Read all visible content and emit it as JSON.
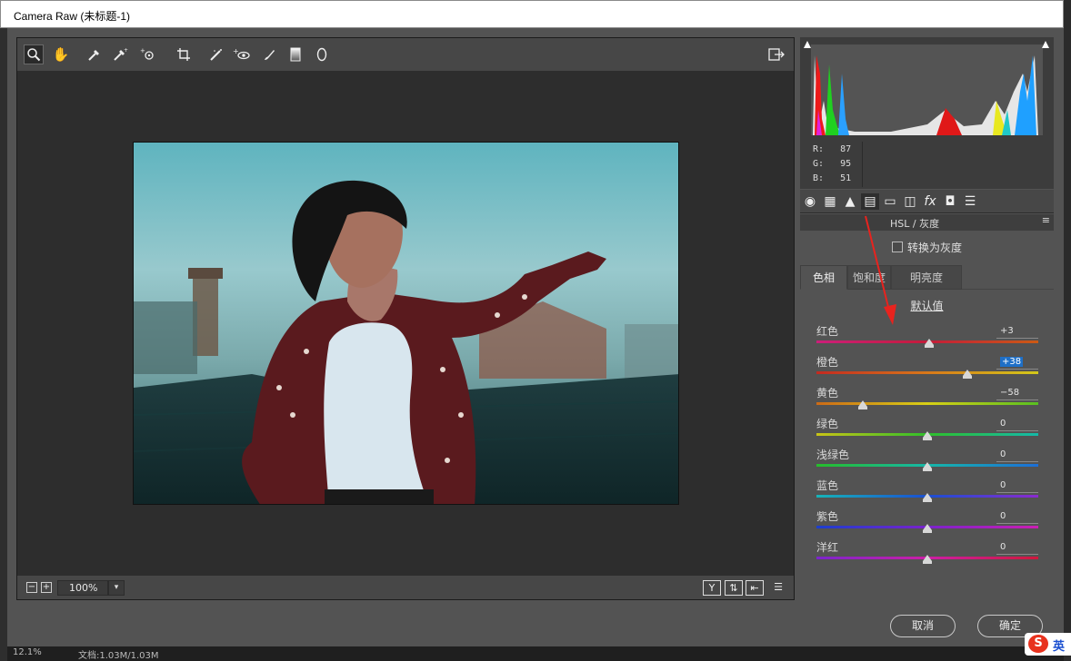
{
  "window": {
    "title": "Camera Raw (未标题-1)"
  },
  "toolbar": {
    "tools": [
      "zoom-icon",
      "hand-icon",
      "white-balance-icon",
      "color-sampler-icon",
      "targeted-adjust-icon",
      "crop-icon",
      "spot-removal-icon",
      "red-eye-icon",
      "adjustment-brush-icon",
      "graduated-filter-icon",
      "radial-filter-icon"
    ],
    "export_icon": "open-export-icon"
  },
  "zoom": {
    "minus": "−",
    "plus": "+",
    "value": "100%"
  },
  "rgb_readout": {
    "r_label": "R:",
    "r": "87",
    "g_label": "G:",
    "g": "95",
    "b_label": "B:",
    "b": "51"
  },
  "panel": {
    "title": "HSL / 灰度",
    "grayscale_label": "转换为灰度",
    "tabs": [
      "色相",
      "饱和度",
      "明亮度"
    ],
    "active_tab": "色相",
    "default_link": "默认值",
    "sliders": [
      {
        "label": "红色",
        "value": "+3",
        "pos": 0.51,
        "gradient": "linear-gradient(to right,#cc1e7a,#c41c3a,#cc5a14)"
      },
      {
        "label": "橙色",
        "value": "+38",
        "pos": 0.68,
        "gradient": "linear-gradient(to right,#c42a20,#d8781a,#d3c81a)",
        "highlight": true
      },
      {
        "label": "黄色",
        "value": "−58",
        "pos": 0.21,
        "gradient": "linear-gradient(to right,#cc6a16,#d8cf16,#58c020)"
      },
      {
        "label": "绿色",
        "value": "0",
        "pos": 0.5,
        "gradient": "linear-gradient(to right,#c9c416,#2fbf2a,#14b9a9)"
      },
      {
        "label": "浅绿色",
        "value": "0",
        "pos": 0.5,
        "gradient": "linear-gradient(to right,#26bd2a,#16b7a8,#1c6fd8)"
      },
      {
        "label": "蓝色",
        "value": "0",
        "pos": 0.5,
        "gradient": "linear-gradient(to right,#16b4b8,#1a4fd2,#8b2ad0)"
      },
      {
        "label": "紫色",
        "value": "0",
        "pos": 0.5,
        "gradient": "linear-gradient(to right,#1b3ecf,#7a22cc,#cc1eb4)"
      },
      {
        "label": "洋红",
        "value": "0",
        "pos": 0.5,
        "gradient": "linear-gradient(to right,#7c25cc,#cc1ea6,#d0183c)"
      }
    ]
  },
  "buttons": {
    "cancel": "取消",
    "ok": "确定"
  },
  "ime": {
    "label": "英"
  },
  "bottom": {
    "zoom": "12.1%",
    "doc": "文档:1.03M/1.03M"
  },
  "colors": {
    "bg": "#535353",
    "preview": "#2d2d2d",
    "accent": "#1e6fc7",
    "arrow": "#e8231e"
  }
}
